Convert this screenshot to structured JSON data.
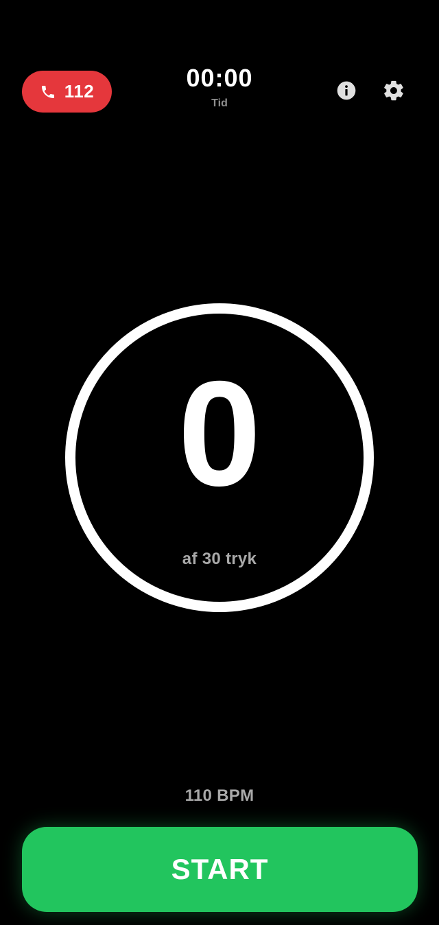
{
  "header": {
    "emergency_call": {
      "label": "112",
      "icon": "phone-icon",
      "color": "#e5373c"
    },
    "timer": {
      "value": "00:00",
      "label": "Tid"
    },
    "info_icon": "info-icon",
    "settings_icon": "gear-icon"
  },
  "counter": {
    "value": "0",
    "target_text": "af 30 tryk"
  },
  "tempo": {
    "label": "110 BPM"
  },
  "start_button": {
    "label": "START",
    "color": "#22c55e"
  }
}
